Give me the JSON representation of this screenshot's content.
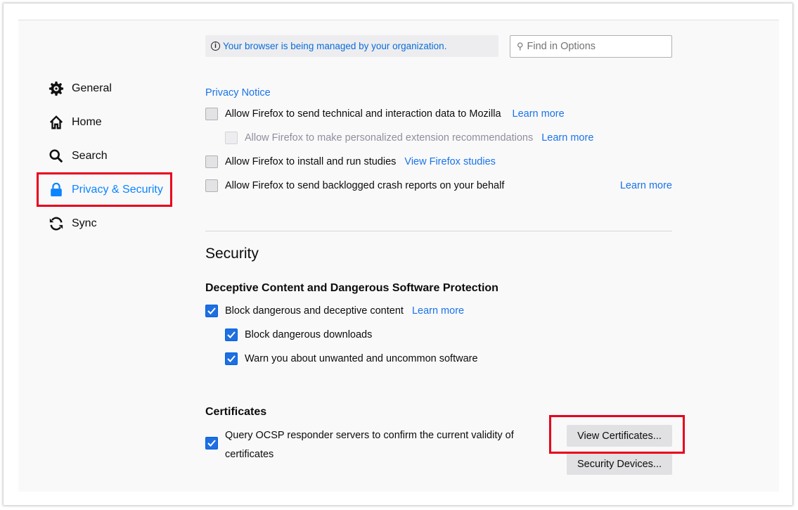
{
  "sidebar": {
    "items": [
      {
        "label": "General",
        "icon": "gear-icon"
      },
      {
        "label": "Home",
        "icon": "home-icon"
      },
      {
        "label": "Search",
        "icon": "search-icon"
      },
      {
        "label": "Privacy & Security",
        "icon": "lock-icon",
        "selected": true
      },
      {
        "label": "Sync",
        "icon": "sync-icon"
      }
    ]
  },
  "header": {
    "managed_notice": "Your browser is being managed by your organization.",
    "search_placeholder": "Find in Options"
  },
  "data_collection": {
    "privacy_notice": "Privacy Notice",
    "options": [
      {
        "label": "Allow Firefox to send technical and interaction data to Mozilla",
        "link": "Learn more",
        "checked": false
      },
      {
        "label": "Allow Firefox to make personalized extension recommendations",
        "link": "Learn more",
        "checked": false,
        "disabled": true
      },
      {
        "label": "Allow Firefox to install and run studies",
        "link": "View Firefox studies",
        "checked": false
      },
      {
        "label": "Allow Firefox to send backlogged crash reports on your behalf",
        "link": "Learn more",
        "checked": false
      }
    ]
  },
  "security": {
    "title": "Security",
    "deceptive_heading": "Deceptive Content and Dangerous Software Protection",
    "options": [
      {
        "label": "Block dangerous and deceptive content",
        "link": "Learn more",
        "checked": true
      },
      {
        "label": "Block dangerous downloads",
        "checked": true
      },
      {
        "label": "Warn you about unwanted and uncommon software",
        "checked": true
      }
    ],
    "certificates_heading": "Certificates",
    "ocsp_line1": "Query OCSP responder servers to confirm the current validity of",
    "ocsp_line2": "certificates",
    "ocsp_checked": true,
    "view_certificates": "View Certificates...",
    "security_devices": "Security Devices..."
  },
  "colors": {
    "accent": "#0a84ff",
    "link": "#1a73e8",
    "highlight": "#e8001c",
    "checkbox_on": "#1f6fe0"
  }
}
